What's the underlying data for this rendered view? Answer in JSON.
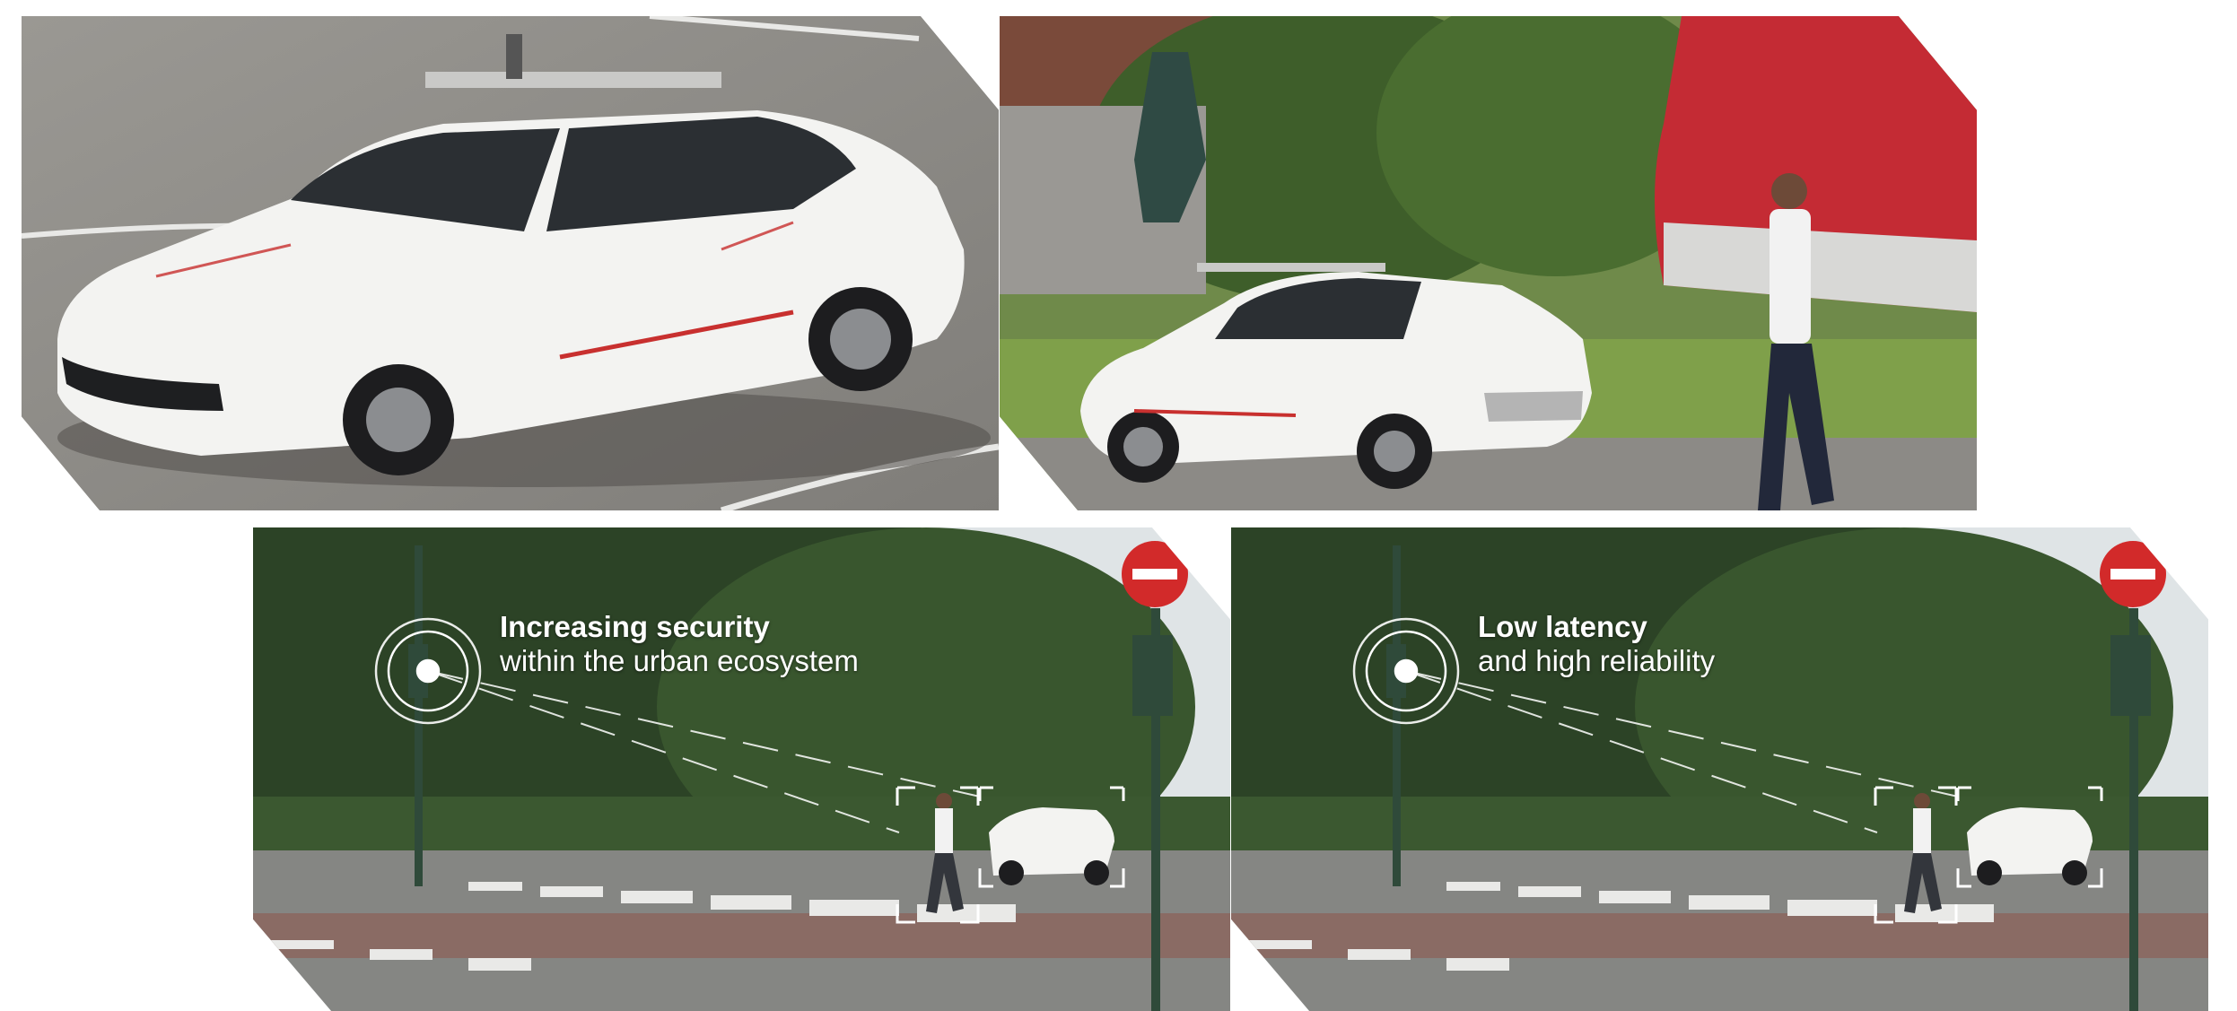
{
  "panels": [
    {
      "id": "test-car-parking-lot",
      "caption": null
    },
    {
      "id": "test-car-near-station",
      "caption": null
    },
    {
      "id": "crosswalk-scene-security",
      "caption": {
        "line1": "Increasing security",
        "line2": "within the urban ecosystem"
      }
    },
    {
      "id": "crosswalk-scene-latency",
      "caption": {
        "line1": "Low latency",
        "line2": "and high reliability"
      }
    }
  ],
  "colors": {
    "asphalt": "#8c8a86",
    "car_white": "#f3f3f1",
    "car_accent": "#c8302f",
    "foliage": "#3c5a2c",
    "sky": "#dfe4e6",
    "train_red": "#c42b34",
    "stop_sign": "#d22a2a",
    "overlay_white": "#ffffff"
  },
  "icons": [
    "sensor-target-icon",
    "no-entry-sign-icon",
    "traffic-light-icon"
  ]
}
